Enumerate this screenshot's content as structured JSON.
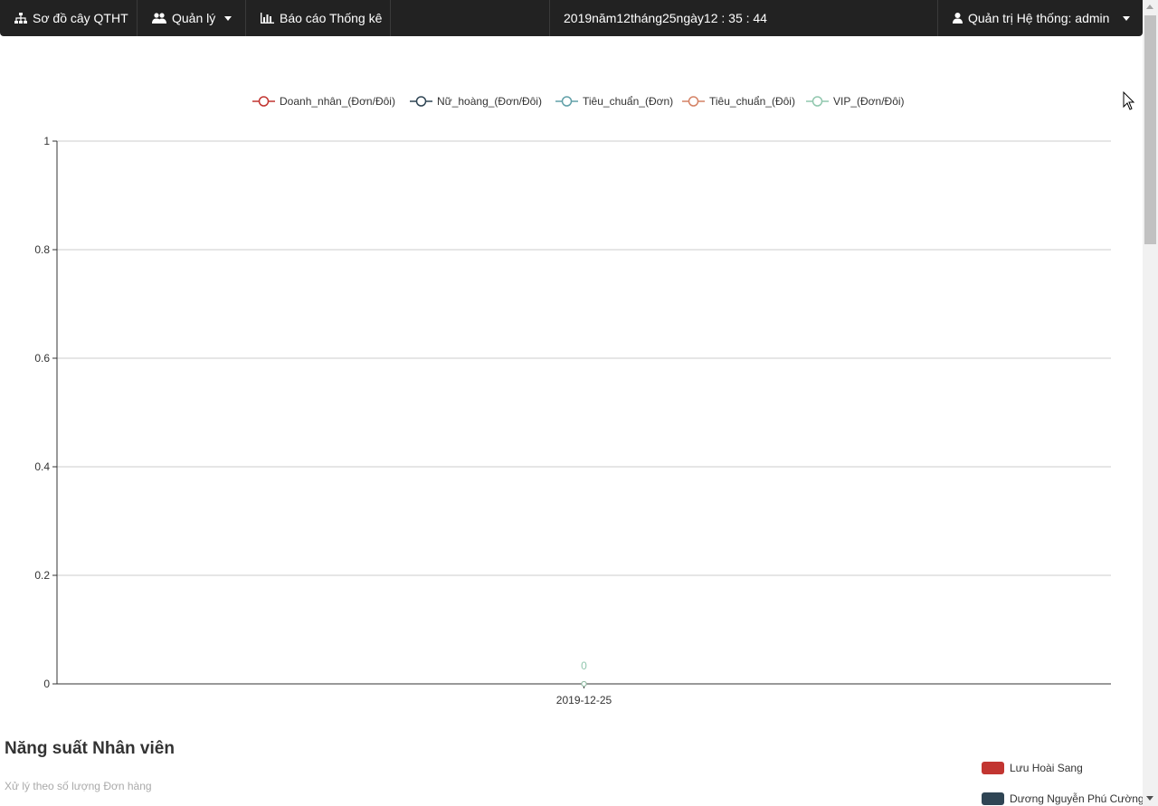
{
  "nav": {
    "tree_label": "Sơ đồ cây QTHT",
    "manage_label": "Quản lý",
    "report_label": "Báo cáo Thống kê",
    "clock": "2019năm12tháng25ngày12 : 35 : 44",
    "user_label": "Quản trị Hệ thống: admin",
    "icons": {
      "tree": "sitemap-icon",
      "manage": "users-icon",
      "report": "bar-chart-icon",
      "user": "user-icon"
    }
  },
  "chart_data": {
    "type": "line",
    "categories": [
      "2019-12-25"
    ],
    "series": [
      {
        "name": "Doanh_nhân_(Đơn/Đôi)",
        "values": [
          0
        ],
        "color": "#c23531"
      },
      {
        "name": "Nữ_hoàng_(Đơn/Đôi)",
        "values": [
          0
        ],
        "color": "#2f4554"
      },
      {
        "name": "Tiêu_chuẩn_(Đơn)",
        "values": [
          0
        ],
        "color": "#61a0a8"
      },
      {
        "name": "Tiêu_chuẩn_(Đôi)",
        "values": [
          0
        ],
        "color": "#d48265"
      },
      {
        "name": "VIP_(Đơn/Đôi)",
        "values": [
          0
        ],
        "color": "#91c7ae"
      }
    ],
    "y_ticks": [
      "0",
      "0.2",
      "0.4",
      "0.6",
      "0.8",
      "1"
    ],
    "ylim": [
      0,
      1
    ],
    "point_label": "0",
    "grid": true,
    "legend_position": "top-center",
    "title": "",
    "xlabel": "",
    "ylabel": ""
  },
  "productivity": {
    "title": "Năng suất Nhân viên",
    "subtitle": "Xử lý theo số lượng Đơn hàng",
    "legend": [
      {
        "name": "Lưu Hoài Sang",
        "color": "#c23531"
      },
      {
        "name": "Dương Nguyễn Phú Cường",
        "color": "#2f4554"
      }
    ]
  }
}
